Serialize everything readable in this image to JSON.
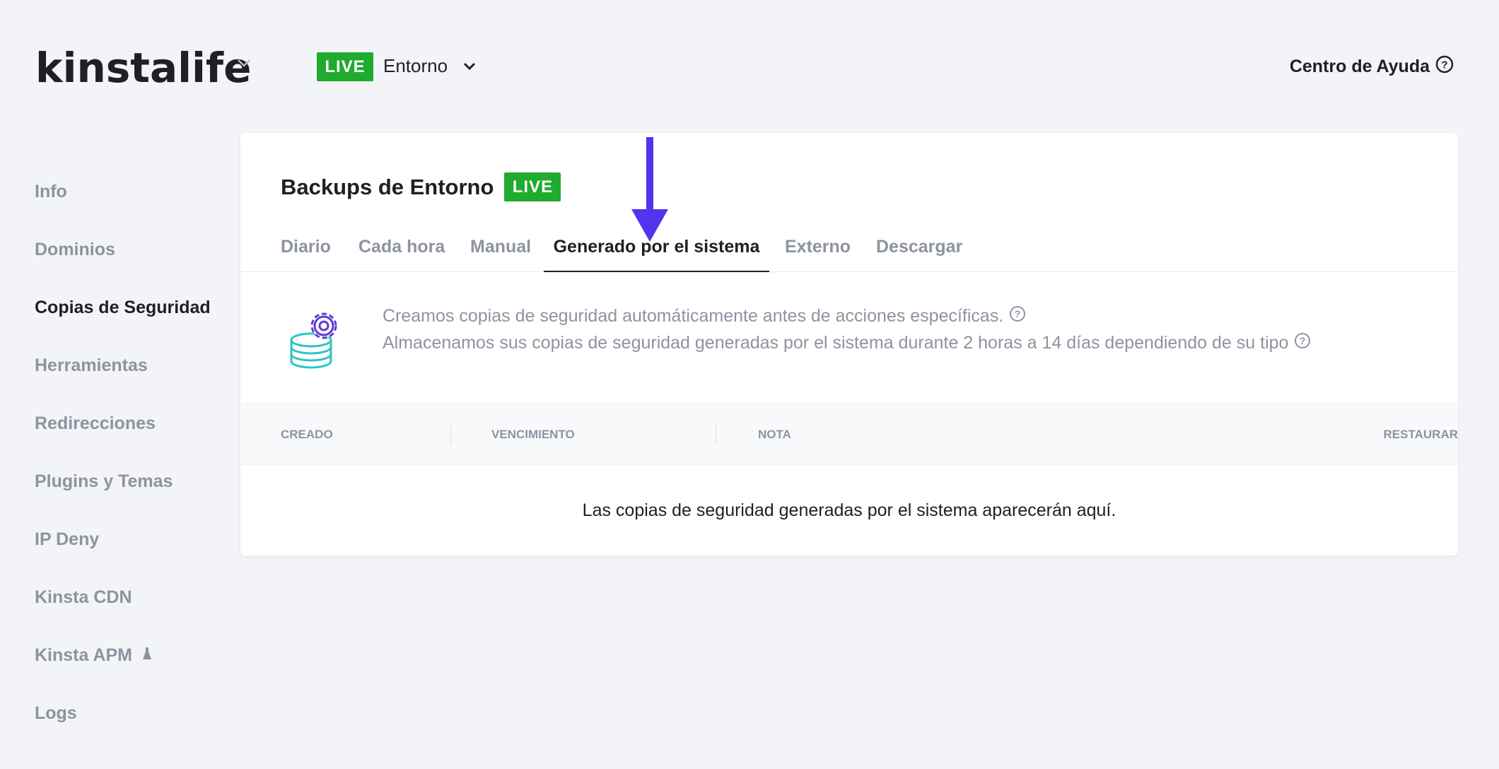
{
  "header": {
    "logo_text": "kinstalife",
    "env_badge": "LIVE",
    "env_label": "Entorno",
    "help_label": "Centro de Ayuda"
  },
  "sidebar": {
    "items": [
      {
        "label": "Info",
        "active": false
      },
      {
        "label": "Dominios",
        "active": false
      },
      {
        "label": "Copias de Seguridad",
        "active": true
      },
      {
        "label": "Herramientas",
        "active": false
      },
      {
        "label": "Redirecciones",
        "active": false
      },
      {
        "label": "Plugins y Temas",
        "active": false
      },
      {
        "label": "IP Deny",
        "active": false
      },
      {
        "label": "Kinsta CDN",
        "active": false
      },
      {
        "label": "Kinsta APM",
        "active": false
      },
      {
        "label": "Logs",
        "active": false
      }
    ]
  },
  "main": {
    "title": "Backups de Entorno",
    "title_badge": "LIVE",
    "tabs": [
      {
        "label": "Diario"
      },
      {
        "label": "Cada hora"
      },
      {
        "label": "Manual"
      },
      {
        "label": "Generado por el sistema",
        "active": true
      },
      {
        "label": "Externo"
      },
      {
        "label": "Descargar"
      }
    ],
    "info": {
      "line1": "Creamos copias de seguridad automáticamente antes de acciones específicas.",
      "line2": "Almacenamos sus copias de seguridad generadas por el sistema durante 2 horas a 14 días dependiendo de su tipo"
    },
    "table": {
      "columns": [
        "CREADO",
        "VENCIMIENTO",
        "NOTA",
        "RESTAURAR"
      ],
      "empty_message": "Las copias de seguridad generadas por el sistema aparecerán aquí."
    }
  },
  "colors": {
    "live_green": "#1fab2d",
    "arrow_purple": "#5333ed",
    "muted_text": "#8d93a0",
    "icon_purple": "#5b3cd8",
    "icon_teal": "#2ec4c4"
  },
  "icons": [
    "chevron-down-icon",
    "help-circle-icon",
    "gear-database-icon",
    "flask-icon",
    "annotation-arrow-icon"
  ]
}
